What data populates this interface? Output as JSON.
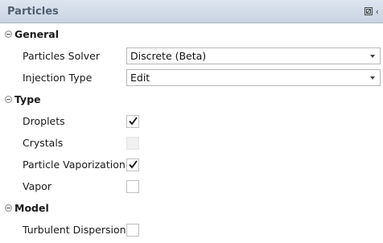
{
  "panel": {
    "title": "Particles",
    "close_glyph": "‹"
  },
  "sections": {
    "general": {
      "title": "General",
      "particles_solver": {
        "label": "Particles Solver",
        "value": "Discrete (Beta)"
      },
      "injection_type": {
        "label": "Injection Type",
        "value": "Edit"
      }
    },
    "type": {
      "title": "Type",
      "droplets": {
        "label": "Droplets",
        "checked": true,
        "enabled": true
      },
      "crystals": {
        "label": "Crystals",
        "checked": false,
        "enabled": false
      },
      "particle_vaporization": {
        "label": "Particle Vaporization",
        "checked": true,
        "enabled": true
      },
      "vapor": {
        "label": "Vapor",
        "checked": false,
        "enabled": true
      }
    },
    "model": {
      "title": "Model",
      "turbulent_dispersion": {
        "label": "Turbulent Dispersion",
        "checked": false,
        "enabled": true
      }
    }
  },
  "icons": {
    "header": [
      "pin-icon",
      "collapse-panel-icon"
    ],
    "section": "collapse-section-icon",
    "dropdown": "chevron-down-icon",
    "check": "checkmark-icon"
  },
  "colors": {
    "titlebar": "#c9d4e1",
    "title_text": "#51606f",
    "field_border": "#b7b7b7"
  }
}
